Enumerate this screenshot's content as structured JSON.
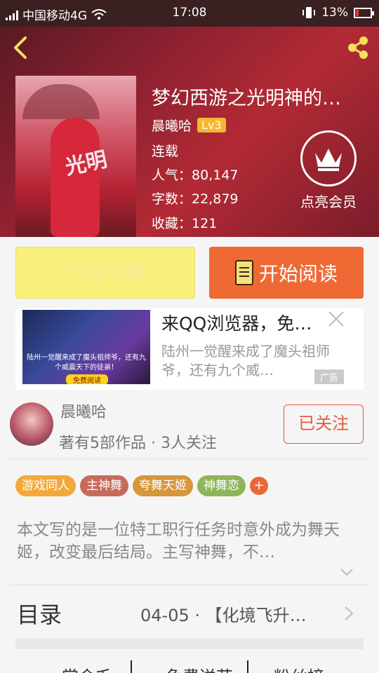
{
  "status_bar": {
    "carrier": "中国移动4G",
    "time": "17:08",
    "battery": "13%"
  },
  "book": {
    "title": "梦幻西游之光明神的…",
    "author": "晨曦哈",
    "level": "Lv3",
    "status": "连载",
    "popularity_label": "人气",
    "popularity": "80,147",
    "words_label": "字数",
    "words": "22,879",
    "favorites_label": "收藏",
    "favorites": "121",
    "cover_title_art": "光明"
  },
  "vip": {
    "label": "点亮会员"
  },
  "actions": {
    "shelf_label": "已在书架",
    "read_label": "开始阅读"
  },
  "ad": {
    "title": "来QQ浏览器，免…",
    "desc": "陆州一觉醒来成了魔头祖师爷，还有九个威…",
    "image_caption": "陆州一觉醒来成了魔头祖师爷，还有九个威震天下的徒弟！",
    "image_button": "免费阅读",
    "tag": "广告"
  },
  "author": {
    "name": "晨曦哈",
    "stats": "著有5部作品 · 3人关注",
    "follow_label": "已关注"
  },
  "tags": [
    {
      "label": "游戏同人",
      "color": "#f2a93b"
    },
    {
      "label": "主神舞",
      "color": "#c66b5b"
    },
    {
      "label": "夸舞天姬",
      "color": "#d6963a"
    },
    {
      "label": "神舞恋",
      "color": "#8fb55a"
    }
  ],
  "tag_more": "+",
  "synopsis": "本文写的是一位特工职行任务时意外成为舞天姬，改变最后结局。主写神舞，不…",
  "toc": {
    "label": "目录",
    "latest": "04-05 · 【化境飞升…"
  },
  "bottom_tabs": [
    "赏金毛",
    "免费送花",
    "粉丝榜"
  ],
  "colors": {
    "accent_orange": "#ef6934",
    "shelf_yellow": "#f8f07a",
    "follow_red": "#e9573f"
  }
}
